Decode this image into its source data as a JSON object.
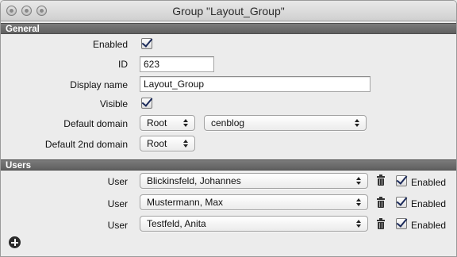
{
  "window": {
    "title": "Group \"Layout_Group\""
  },
  "general": {
    "header": "General",
    "enabled_label": "Enabled",
    "enabled": true,
    "id_label": "ID",
    "id_value": "623",
    "display_name_label": "Display name",
    "display_name_value": "Layout_Group",
    "visible_label": "Visible",
    "visible": true,
    "default_domain_label": "Default domain",
    "default_domain_value": "Root",
    "default_domain_secondary_value": "cenblog",
    "default_2nd_domain_label": "Default 2nd domain",
    "default_2nd_domain_value": "Root"
  },
  "users": {
    "header": "Users",
    "rows": [
      {
        "label": "User",
        "value": "Blickinsfeld, Johannes",
        "enabled_label": "Enabled",
        "enabled": true
      },
      {
        "label": "User",
        "value": "Mustermann, Max",
        "enabled_label": "Enabled",
        "enabled": true
      },
      {
        "label": "User",
        "value": "Testfeld, Anita",
        "enabled_label": "Enabled",
        "enabled": true
      }
    ]
  },
  "icons": {
    "add": "add-circle-icon",
    "delete": "trash-icon",
    "checkbox": "checkmark-icon"
  }
}
